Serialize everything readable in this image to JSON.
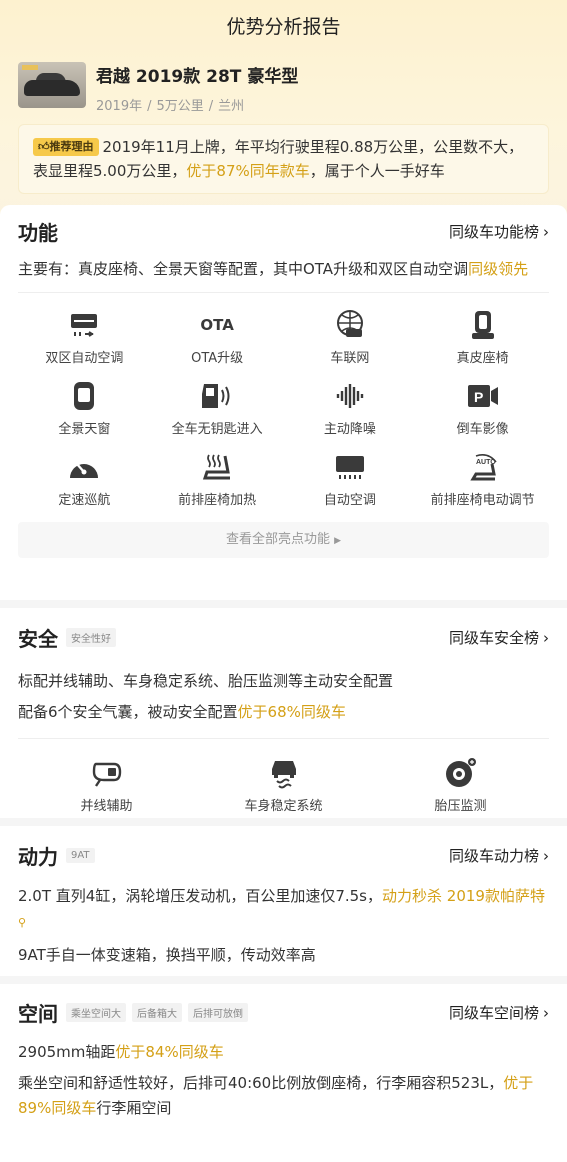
{
  "page_title": "优势分析报告",
  "car": {
    "name": "君越 2019款 28T 豪华型",
    "year": "2019年",
    "mileage": "5万公里",
    "city": "兰州",
    "sep": "/"
  },
  "reason": {
    "badge": "推荐理由",
    "text_1": "2019年11月上牌，年平均行驶里程0.88万公里，公里数不大，表显里程5.00万公里，",
    "highlight": "优于87%同年款车",
    "text_2": "，属于个人一手好车"
  },
  "function": {
    "title": "功能",
    "rank_link": "同级车功能榜",
    "desc_1": "主要有：真皮座椅、全景天窗等配置，其中OTA升级和双区自动空调",
    "desc_hl": "同级领先",
    "features": [
      {
        "icon": "dual-zone-ac-icon",
        "label": "双区自动空调"
      },
      {
        "icon": "ota-icon",
        "label": "OTA升级",
        "icon_text": "OTA"
      },
      {
        "icon": "connected-car-icon",
        "label": "车联网"
      },
      {
        "icon": "leather-seat-icon",
        "label": "真皮座椅"
      },
      {
        "icon": "sunroof-icon",
        "label": "全景天窗"
      },
      {
        "icon": "keyless-entry-icon",
        "label": "全车无钥匙进入"
      },
      {
        "icon": "noise-cancel-icon",
        "label": "主动降噪"
      },
      {
        "icon": "reverse-camera-icon",
        "label": "倒车影像"
      },
      {
        "icon": "cruise-control-icon",
        "label": "定速巡航"
      },
      {
        "icon": "seat-heating-icon",
        "label": "前排座椅加热"
      },
      {
        "icon": "auto-ac-icon",
        "label": "自动空调"
      },
      {
        "icon": "power-seat-icon",
        "label": "前排座椅电动调节"
      }
    ],
    "more_label": "查看全部亮点功能"
  },
  "safety": {
    "title": "安全",
    "tag": "安全性好",
    "rank_link": "同级车安全榜",
    "desc_1": "标配并线辅助、车身稳定系统、胎压监测等主动安全配置",
    "desc_2": "配备6个安全气囊，被动安全配置",
    "desc_2_hl": "优于68%同级车",
    "features": [
      {
        "icon": "lane-change-assist-icon",
        "label": "并线辅助"
      },
      {
        "icon": "stability-control-icon",
        "label": "车身稳定系统"
      },
      {
        "icon": "tire-pressure-icon",
        "label": "胎压监测"
      }
    ]
  },
  "power": {
    "title": "动力",
    "tag": "9AT",
    "rank_link": "同级车动力榜",
    "desc_1": "2.0T 直列4缸，涡轮增压发动机，百公里加速仅7.5s，",
    "desc_1_hl": "动力秒杀 2019款帕萨特",
    "desc_2": "9AT手自一体变速箱，换挡平顺，传动效率高"
  },
  "space": {
    "title": "空间",
    "tags": [
      "乘坐空间大",
      "后备箱大",
      "后排可放倒"
    ],
    "rank_link": "同级车空间榜",
    "desc_1": "2905mm轴距",
    "desc_1_hl": "优于84%同级车",
    "desc_2": "乘坐空间和舒适性较好，后排可40:60比例放倒座椅，行李厢容积523L，",
    "desc_2_hl": "优于89%同级车",
    "desc_2_tail": "行李厢空间"
  },
  "colors": {
    "highlight": "#d4a017",
    "badge_bg": "#f6c94a",
    "header_bg": "#fdf1cf"
  }
}
